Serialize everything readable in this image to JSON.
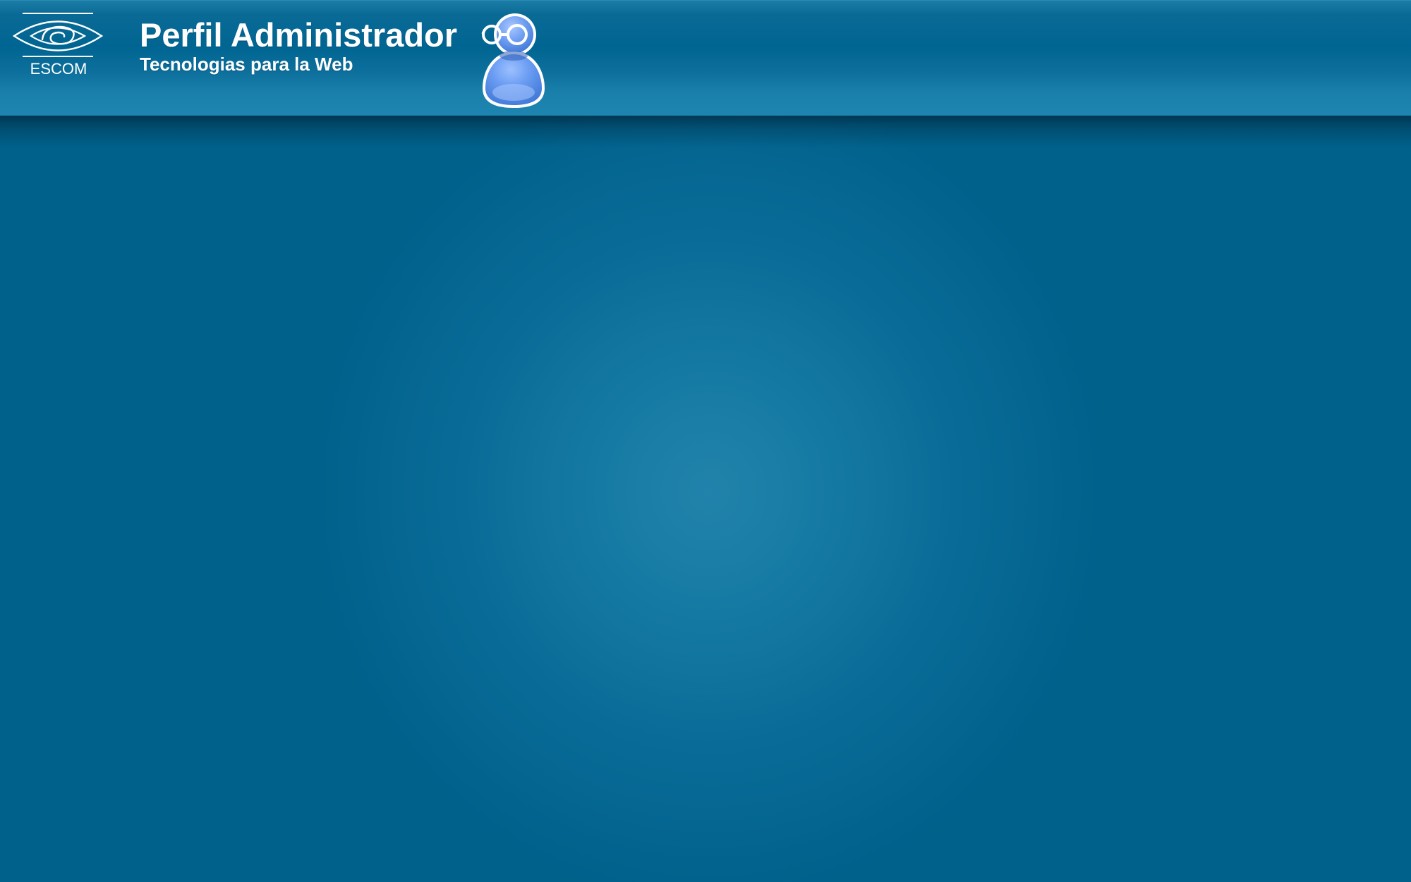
{
  "header": {
    "logo": {
      "text": "ESCOM",
      "icon": "escom-eye-logo"
    },
    "title": "Perfil Administrador",
    "subtitle": "Tecnologias para la Web",
    "avatar": {
      "icon": "user-with-glasses-icon"
    }
  },
  "colors": {
    "header_top": "#1b7ea6",
    "header_mid": "#006592",
    "header_bottom": "#1d85b0",
    "content_center": "#2183aa",
    "content_edge": "#00618b",
    "text": "#ffffff",
    "avatar_blue": "#5c8ff0"
  }
}
